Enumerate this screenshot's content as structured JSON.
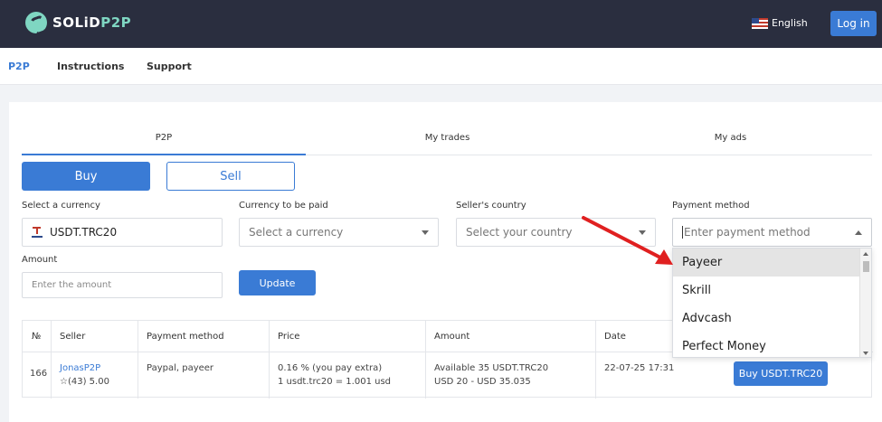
{
  "header": {
    "logo_text_a": "SOLiD",
    "logo_text_b": "P2P",
    "language": "English",
    "login_label": "Log in"
  },
  "subnav": {
    "items": [
      {
        "label": "P2P",
        "active": true
      },
      {
        "label": "Instructions",
        "active": false
      },
      {
        "label": "Support",
        "active": false
      }
    ]
  },
  "tabs": [
    {
      "label": "P2P",
      "active": true
    },
    {
      "label": "My trades",
      "active": false
    },
    {
      "label": "My ads",
      "active": false
    }
  ],
  "actions": {
    "buy_label": "Buy",
    "sell_label": "Sell",
    "update_label": "Update"
  },
  "filters": {
    "currency_label": "Select a currency",
    "currency_value": "USDT.TRC20",
    "paid_currency_label": "Currency to be paid",
    "paid_currency_placeholder": "Select a currency",
    "country_label": "Seller's country",
    "country_placeholder": "Select your country",
    "payment_label": "Payment method",
    "payment_placeholder": "Enter payment method",
    "amount_label": "Amount",
    "amount_placeholder": "Enter the amount"
  },
  "payment_dropdown": {
    "options": [
      "Payeer",
      "Skrill",
      "Advcash",
      "Perfect Money"
    ],
    "highlighted": "Payeer"
  },
  "table": {
    "headers": [
      "№",
      "Seller",
      "Payment method",
      "Price",
      "Amount",
      "Date"
    ],
    "rows": [
      {
        "number": "166",
        "seller_name": "JonasP2P",
        "seller_rating": "☆(43) 5.00",
        "payment": "Paypal, payeer",
        "price_line1": "0.16 % (you pay extra)",
        "price_line2": "1 usdt.trc20 = 1.001 usd",
        "amount_line1": "Available 35 USDT.TRC20",
        "amount_line2": "USD 20 - USD 35.035",
        "date": "22-07-25 17:31",
        "action_label": "Buy USDT.TRC20"
      }
    ]
  },
  "colors": {
    "header_bg": "#2a2e3f",
    "accent": "#3a7bd5",
    "logo_accent": "#7fd6c2",
    "annotation": "#e02020"
  }
}
